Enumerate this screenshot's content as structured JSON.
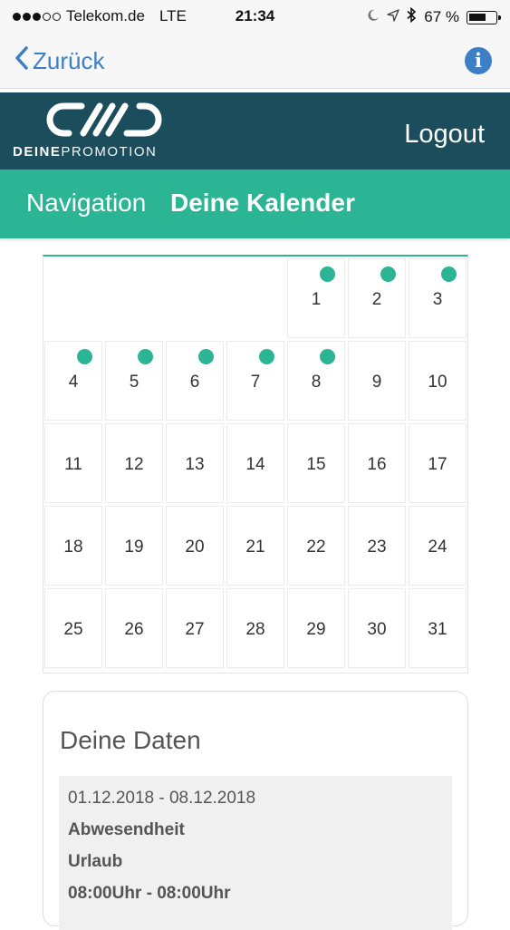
{
  "status_bar": {
    "carrier": "Telekom.de",
    "network": "LTE",
    "time": "21:34",
    "battery_percent": "67 %",
    "battery_level": 0.67,
    "signal_bars": 3,
    "signal_total": 5
  },
  "nav_bar": {
    "back_label": "Zurück",
    "info_icon": "info-icon",
    "accent_color": "#3d7fc7"
  },
  "app_header": {
    "logo_text_bold": "DEINE",
    "logo_text_light": "PROMOTION",
    "logout_label": "Logout",
    "background_color": "#1b4d5c"
  },
  "sub_header": {
    "nav_label": "Navigation",
    "title": "Deine Kalender",
    "background_color": "#2bb594"
  },
  "calendar": {
    "weeks": [
      [
        null,
        null,
        null,
        null,
        {
          "day": "1",
          "event": true
        },
        {
          "day": "2",
          "event": true
        },
        {
          "day": "3",
          "event": true
        }
      ],
      [
        {
          "day": "4",
          "event": true
        },
        {
          "day": "5",
          "event": true
        },
        {
          "day": "6",
          "event": true
        },
        {
          "day": "7",
          "event": true
        },
        {
          "day": "8",
          "event": true
        },
        {
          "day": "9",
          "event": false
        },
        {
          "day": "10",
          "event": false
        }
      ],
      [
        {
          "day": "11",
          "event": false
        },
        {
          "day": "12",
          "event": false
        },
        {
          "day": "13",
          "event": false
        },
        {
          "day": "14",
          "event": false
        },
        {
          "day": "15",
          "event": false
        },
        {
          "day": "16",
          "event": false
        },
        {
          "day": "17",
          "event": false
        }
      ],
      [
        {
          "day": "18",
          "event": false
        },
        {
          "day": "19",
          "event": false
        },
        {
          "day": "20",
          "event": false
        },
        {
          "day": "21",
          "event": false
        },
        {
          "day": "22",
          "event": false
        },
        {
          "day": "23",
          "event": false
        },
        {
          "day": "24",
          "event": false
        }
      ],
      [
        {
          "day": "25",
          "event": false
        },
        {
          "day": "26",
          "event": false
        },
        {
          "day": "27",
          "event": false
        },
        {
          "day": "28",
          "event": false
        },
        {
          "day": "29",
          "event": false
        },
        {
          "day": "30",
          "event": false
        },
        {
          "day": "31",
          "event": false
        }
      ]
    ]
  },
  "data_card": {
    "title": "Deine Daten",
    "entries": [
      {
        "date_range": "01.12.2018 - 08.12.2018",
        "type": "Abwesendheit",
        "reason": "Urlaub",
        "time_range": "08:00Uhr - 08:00Uhr"
      }
    ]
  }
}
